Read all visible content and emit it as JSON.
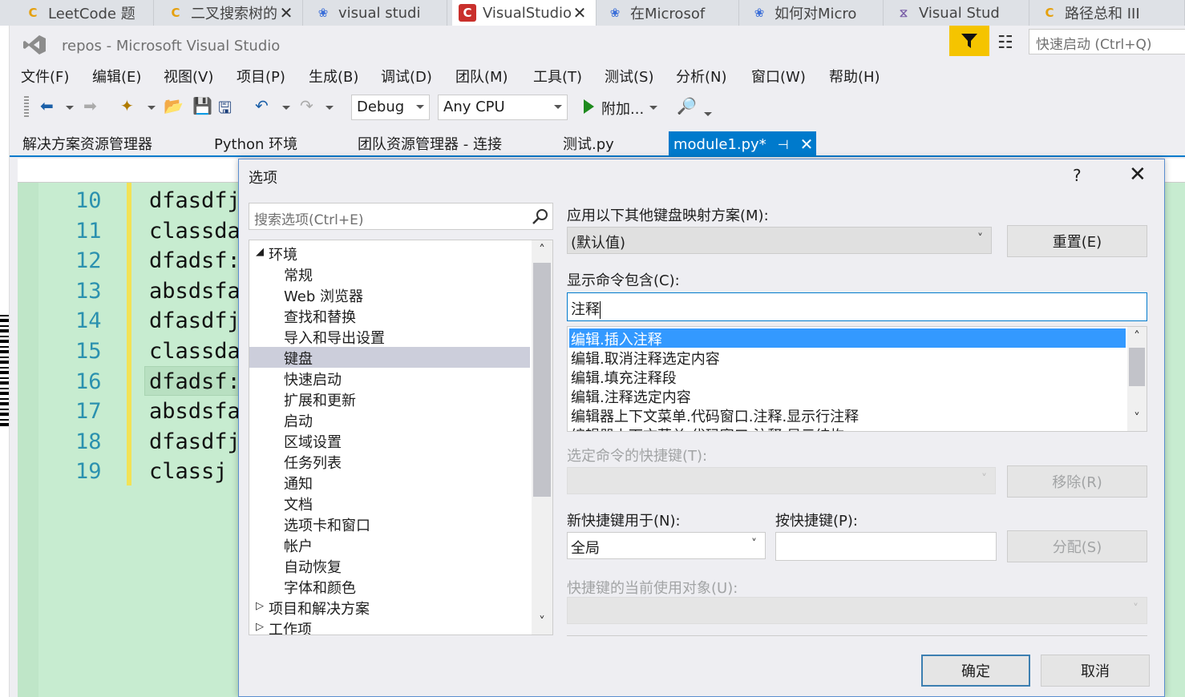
{
  "browser": {
    "tabs": [
      {
        "title": "LeetCode 题",
        "icon": "leetcode-icon",
        "closable": false,
        "active": false
      },
      {
        "title": "二叉搜索树的",
        "icon": "leetcode-icon",
        "closable": true,
        "active": false
      },
      {
        "title": "visual studi",
        "icon": "baidu-paw-icon",
        "closable": false,
        "active": false
      },
      {
        "title": "VisualStudio",
        "icon": "csdn-icon",
        "closable": true,
        "active": true
      },
      {
        "title": "在Microsof",
        "icon": "baidu-paw-icon",
        "closable": false,
        "active": false
      },
      {
        "title": "如何对Micro",
        "icon": "baidu-paw-icon",
        "closable": false,
        "active": false
      },
      {
        "title": "Visual Stud",
        "icon": "visual-studio-icon",
        "closable": false,
        "active": false
      },
      {
        "title": "路径总和 III",
        "icon": "leetcode-icon",
        "closable": false,
        "active": false
      }
    ]
  },
  "vs": {
    "title": "repos - Microsoft Visual Studio",
    "quick_launch_placeholder": "快速启动 (Ctrl+Q)",
    "menu": [
      "文件(F)",
      "编辑(E)",
      "视图(V)",
      "项目(P)",
      "生成(B)",
      "调试(D)",
      "团队(M)",
      "工具(T)",
      "测试(S)",
      "分析(N)",
      "窗口(W)",
      "帮助(H)"
    ],
    "toolbar": {
      "configuration": "Debug",
      "platform": "Any CPU",
      "attach_label": "附加..."
    },
    "doc_tabs": [
      {
        "label": "解决方案资源管理器"
      },
      {
        "label": "Python 环境"
      },
      {
        "label": "团队资源管理器 - 连接"
      },
      {
        "label": "测试.py"
      },
      {
        "label": "module1.py*",
        "active": true
      }
    ],
    "editor": {
      "lines": [
        {
          "num": "10",
          "text": "dfasdfj"
        },
        {
          "num": "11",
          "text": "classda"
        },
        {
          "num": "12",
          "text": "dfadsf:"
        },
        {
          "num": "13",
          "text": "absdsfa"
        },
        {
          "num": "14",
          "text": "dfasdfj"
        },
        {
          "num": "15",
          "text": "classda"
        },
        {
          "num": "16",
          "text": "dfadsf:"
        },
        {
          "num": "17",
          "text": "absdsfa"
        },
        {
          "num": "18",
          "text": "dfasdfj"
        },
        {
          "num": "19",
          "text": "classj"
        }
      ]
    }
  },
  "dialog": {
    "title": "选项",
    "help": "?",
    "search_placeholder": "搜索选项(Ctrl+E)",
    "tree": [
      {
        "label": "环境",
        "level": 0,
        "expanded": true
      },
      {
        "label": "常规",
        "level": 1
      },
      {
        "label": "Web 浏览器",
        "level": 1
      },
      {
        "label": "查找和替换",
        "level": 1
      },
      {
        "label": "导入和导出设置",
        "level": 1
      },
      {
        "label": "键盘",
        "level": 1,
        "selected": true
      },
      {
        "label": "快速启动",
        "level": 1
      },
      {
        "label": "扩展和更新",
        "level": 1
      },
      {
        "label": "启动",
        "level": 1
      },
      {
        "label": "区域设置",
        "level": 1
      },
      {
        "label": "任务列表",
        "level": 1
      },
      {
        "label": "通知",
        "level": 1
      },
      {
        "label": "文档",
        "level": 1
      },
      {
        "label": "选项卡和窗口",
        "level": 1
      },
      {
        "label": "帐户",
        "level": 1
      },
      {
        "label": "自动恢复",
        "level": 1
      },
      {
        "label": "字体和颜色",
        "level": 1
      },
      {
        "label": "项目和解决方案",
        "level": 0,
        "expanded": false
      },
      {
        "label": "工作项",
        "level": 0,
        "expanded": false
      }
    ],
    "keyboard": {
      "mapping_label": "应用以下其他键盘映射方案(M):",
      "mapping_value": "(默认值)",
      "reset_button": "重置(E)",
      "show_commands_label": "显示命令包含(C):",
      "show_commands_value": "注释",
      "commands": [
        "编辑.插入注释",
        "编辑.取消注释选定内容",
        "编辑.填充注释段",
        "编辑.注释选定内容",
        "编辑器上下文菜单.代码窗口.注释.显示行注释",
        "编辑器上下文菜单.代码窗口.注释.显示结构"
      ],
      "selected_command_index": 0,
      "shortcut_label": "选定命令的快捷键(T):",
      "remove_button": "移除(R)",
      "use_new_shortcut_label": "新快捷键用于(N):",
      "use_new_shortcut_value": "全局",
      "press_shortcut_label": "按快捷键(P):",
      "press_shortcut_value": "",
      "assign_button": "分配(S)",
      "used_by_label": "快捷键的当前使用对象(U):"
    },
    "ok_button": "确定",
    "cancel_button": "取消"
  }
}
